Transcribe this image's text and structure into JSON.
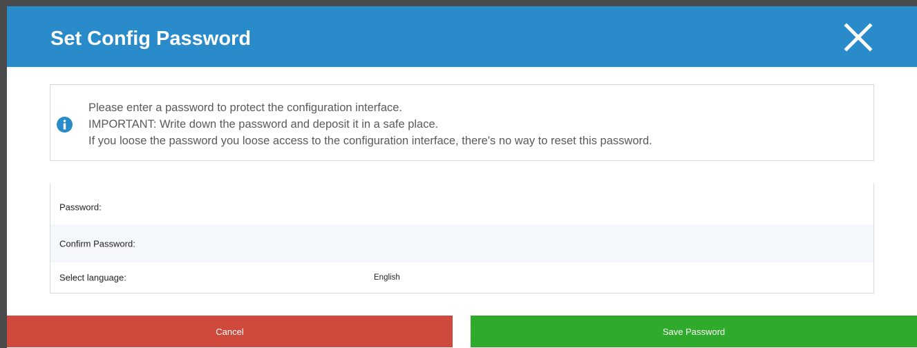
{
  "dialog": {
    "title": "Set Config Password",
    "close_icon": "close-icon"
  },
  "info": {
    "icon": "info-icon",
    "icon_color": "#2a8bca",
    "lines": [
      "Please enter a password to protect the configuration interface.",
      "IMPORTANT: Write down the password and deposit it in a safe place.",
      "If you loose the password you loose access to the configuration interface, there's no way to reset this password."
    ]
  },
  "form": {
    "password_label": "Password:",
    "password_value": "",
    "confirm_label": "Confirm Password:",
    "confirm_value": "",
    "language_label": "Select language:",
    "language_value": "English"
  },
  "buttons": {
    "cancel_label": "Cancel",
    "cancel_color": "#cf4a3c",
    "save_label": "Save Password",
    "save_color": "#30aa2a"
  },
  "colors": {
    "header": "#2a8bca",
    "row_alt": "#f4f8fc"
  }
}
